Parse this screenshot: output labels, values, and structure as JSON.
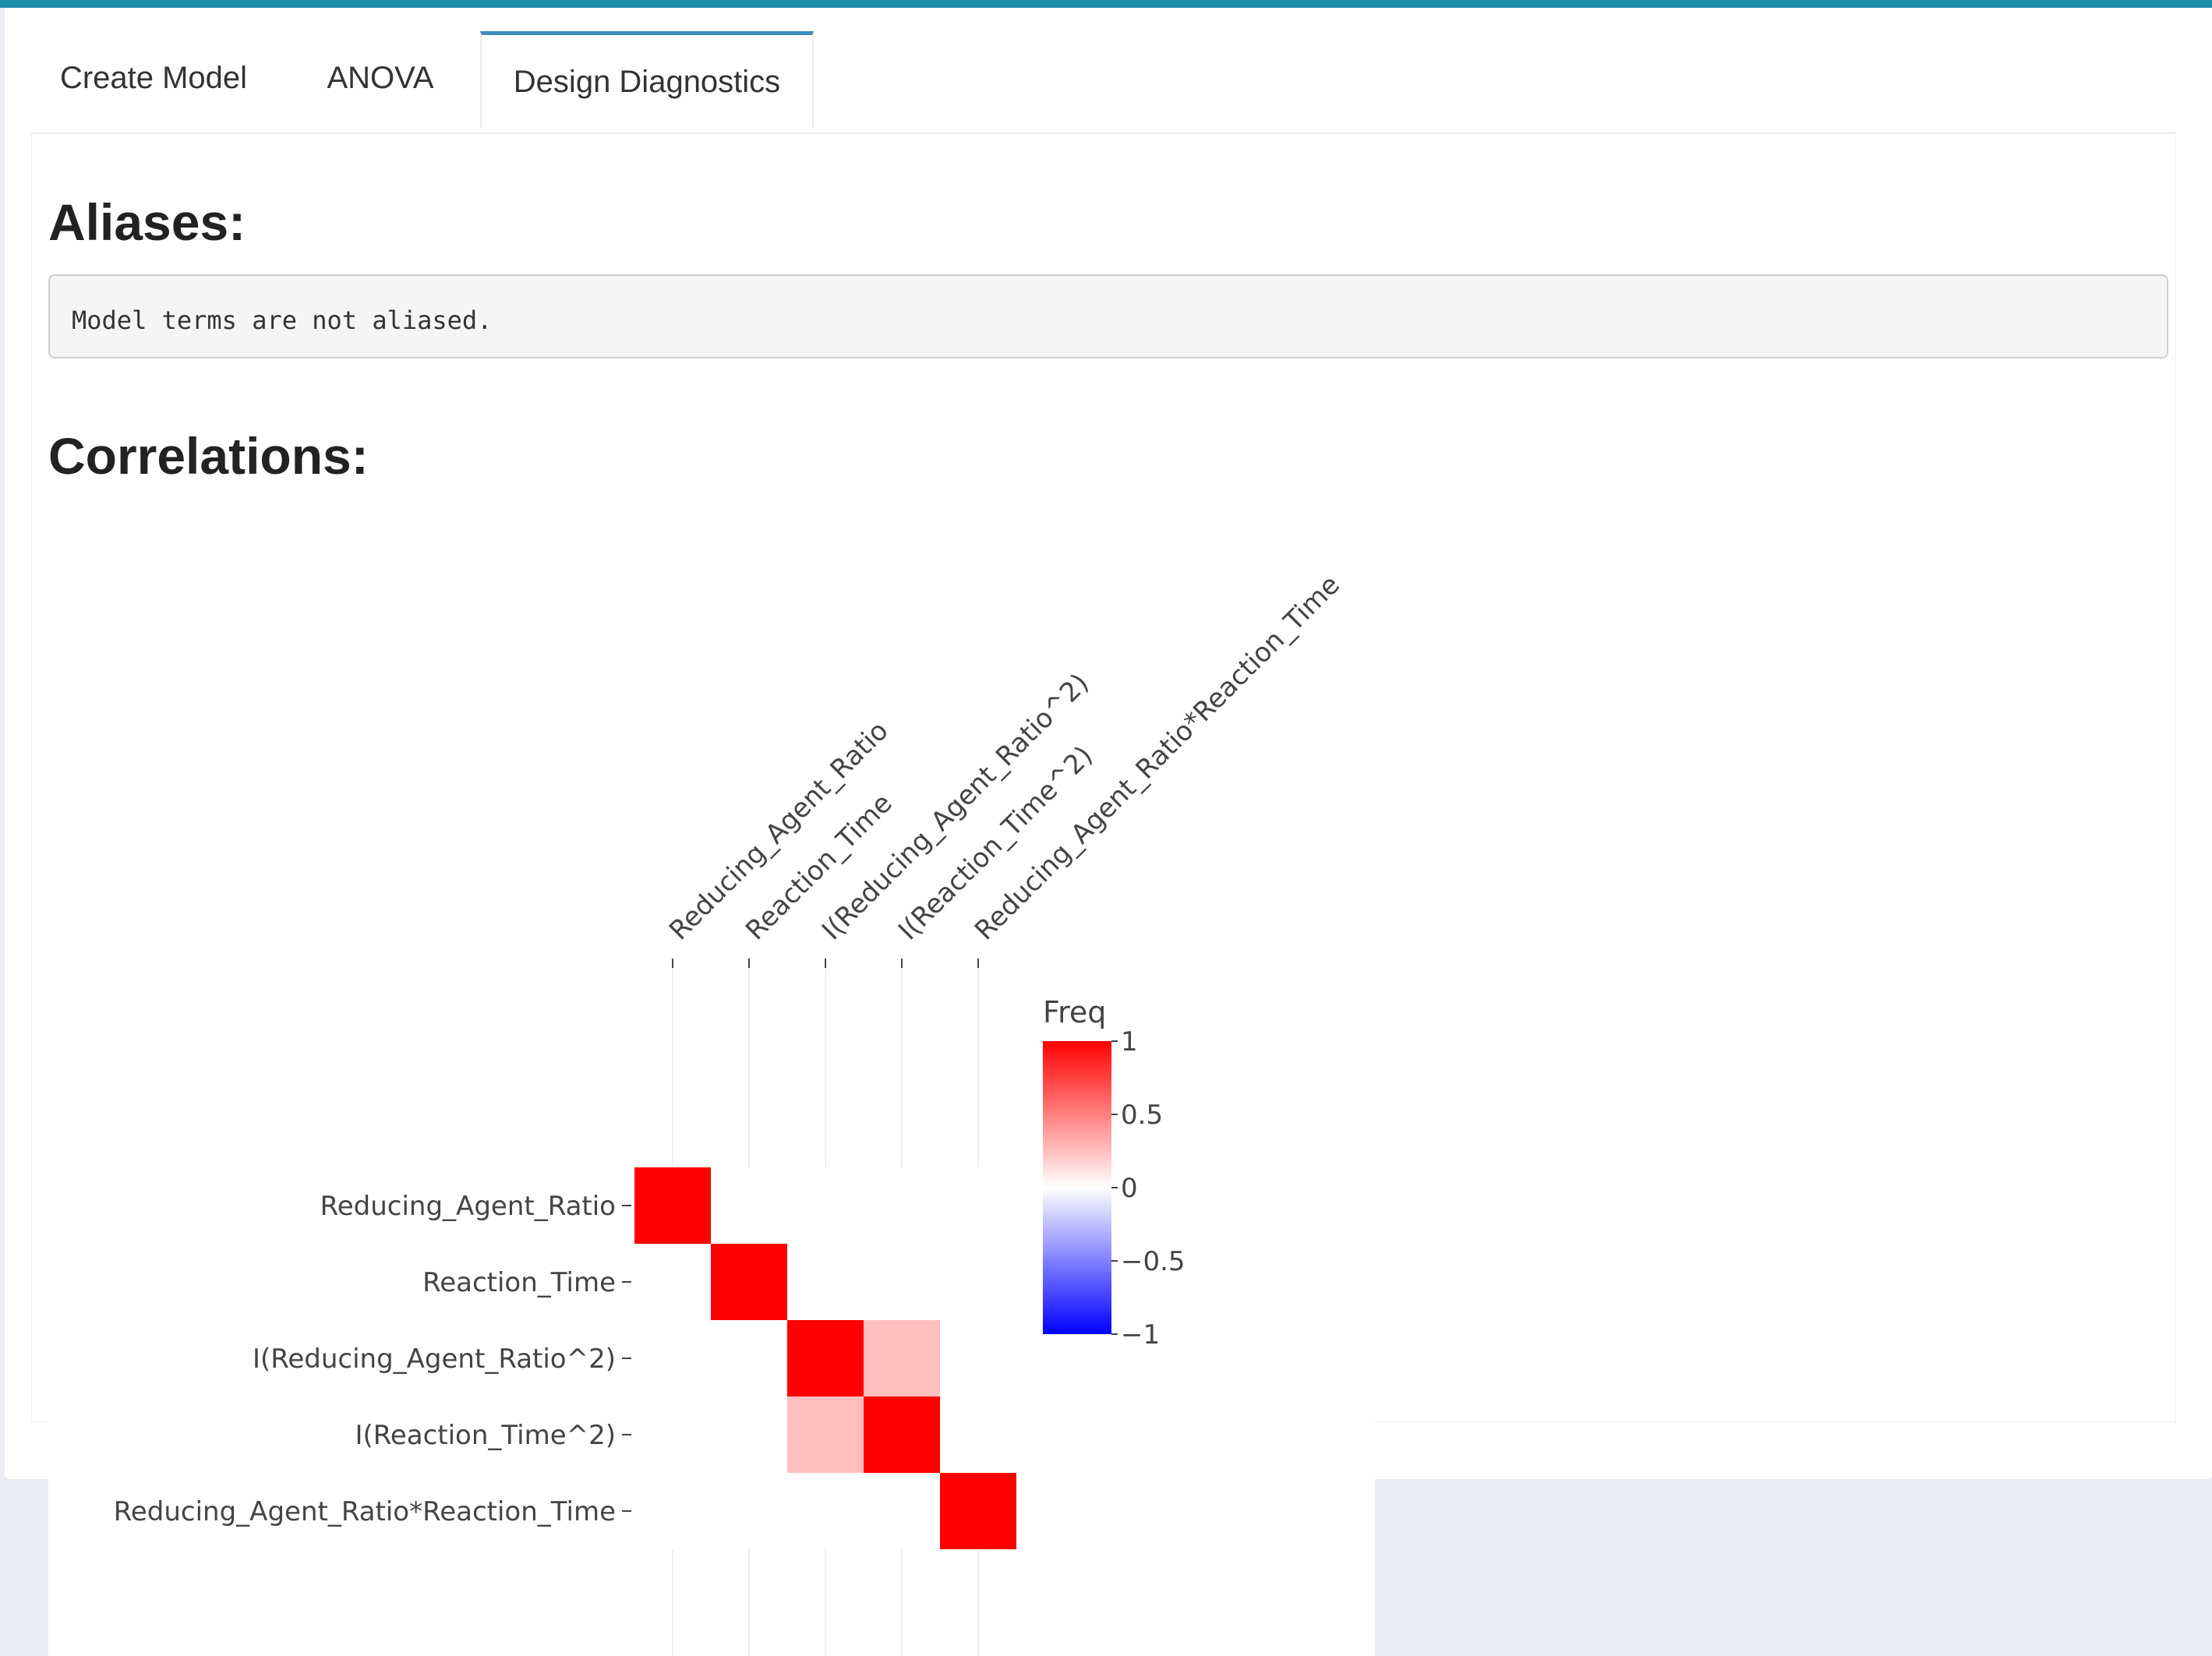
{
  "tabs": [
    {
      "label": "Create Model",
      "active": false
    },
    {
      "label": "ANOVA",
      "active": false
    },
    {
      "label": "Design Diagnostics",
      "active": true
    }
  ],
  "aliases": {
    "heading": "Aliases:",
    "message": "Model terms are not aliased."
  },
  "correlations": {
    "heading": "Correlations:"
  },
  "colors": {
    "accent": "#3c8dbc",
    "top_line": "#1b8fa8",
    "positive": "#ff0000",
    "negative": "#0000ff"
  },
  "chart_data": {
    "type": "heatmap",
    "x_labels": [
      "Reducing_Agent_Ratio",
      "Reaction_Time",
      "I(Reducing_Agent_Ratio^2)",
      "I(Reaction_Time^2)",
      "Reducing_Agent_Ratio*Reaction_Time"
    ],
    "y_labels": [
      "Reducing_Agent_Ratio",
      "Reaction_Time",
      "I(Reducing_Agent_Ratio^2)",
      "I(Reaction_Time^2)",
      "Reducing_Agent_Ratio*Reaction_Time"
    ],
    "z": [
      [
        1,
        0,
        0,
        0,
        0
      ],
      [
        0,
        1,
        0,
        0,
        0
      ],
      [
        0,
        0,
        1,
        0.25,
        0
      ],
      [
        0,
        0,
        0.25,
        1,
        0
      ],
      [
        0,
        0,
        0,
        0,
        1
      ]
    ],
    "colorbar": {
      "title": "Freq",
      "range": [
        -1,
        1
      ],
      "ticks": [
        1,
        0.5,
        0,
        -0.5,
        -1
      ],
      "tick_labels": [
        "1",
        "0.5",
        "0",
        "−0.5",
        "−1"
      ]
    }
  }
}
